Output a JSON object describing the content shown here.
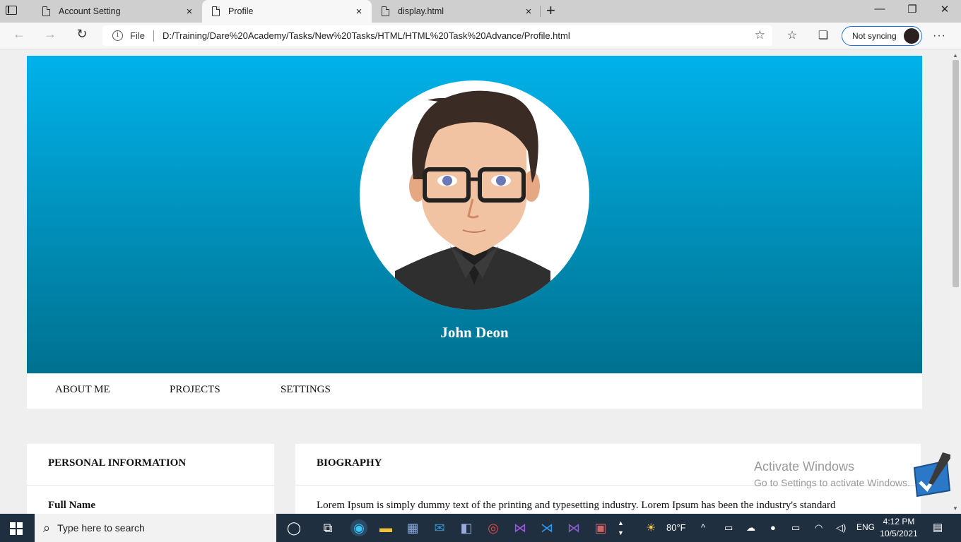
{
  "browser": {
    "tabs": [
      {
        "title": "Account Setting",
        "close": "×"
      },
      {
        "title": "Profile",
        "close": "×"
      },
      {
        "title": "display.html",
        "close": "×"
      }
    ],
    "new_tab": "+",
    "window_controls": {
      "minimize": "—",
      "restore": "❐",
      "close": "✕"
    },
    "back": "←",
    "forward": "→",
    "refresh": "↻",
    "info_glyph": "i",
    "scheme": "File",
    "url": "D:/Training/Dare%20Academy/Tasks/New%20Tasks/HTML/HTML%20Task%20Advance/Profile.html",
    "fav_glyph": "☆",
    "collections_glyph": "❏",
    "sync_label": "Not syncing",
    "more": "···"
  },
  "profile": {
    "name": "John Deon"
  },
  "nav": {
    "items": [
      "ABOUT ME",
      "PROJECTS",
      "SETTINGS"
    ]
  },
  "personal": {
    "heading": "PERSONAL INFORMATION",
    "field1": "Full Name"
  },
  "biography": {
    "heading": "BIOGRAPHY",
    "text": "Lorem Ipsum is simply dummy text of the printing and typesetting industry. Lorem Ipsum has been the industry's standard"
  },
  "watermark": {
    "title": "Activate Windows",
    "subtitle": "Go to Settings to activate Windows."
  },
  "taskbar": {
    "search_placeholder": "Type here to search",
    "weather": "80°F",
    "lang": "ENG",
    "time": "4:12 PM",
    "date": "10/5/2021"
  },
  "colors": {
    "hero_top": "#01b2ea",
    "hero_bottom": "#00718f",
    "page_bg": "#efefef",
    "taskbar": "#1f2f3f"
  }
}
